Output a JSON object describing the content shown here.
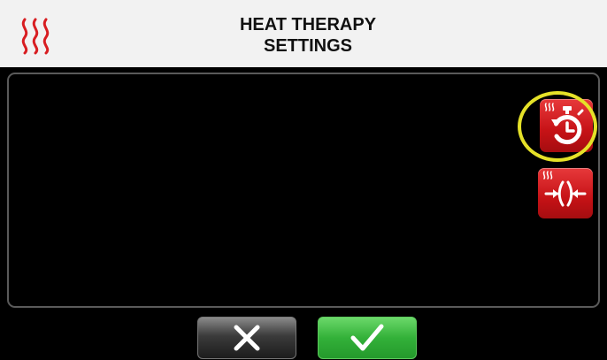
{
  "header": {
    "title_line1": "HEAT THERAPY",
    "title_line2": "SETTINGS",
    "icon": "heat-waves-icon"
  },
  "side_buttons": [
    {
      "icon": "heat-timer-icon",
      "highlighted": true
    },
    {
      "icon": "heat-compress-icon",
      "highlighted": false
    }
  ],
  "actions": {
    "cancel_icon": "close-icon",
    "confirm_icon": "checkmark-icon"
  },
  "colors": {
    "accent_red": "#c61216",
    "confirm_green": "#33b139",
    "highlight_yellow": "#e5e128",
    "header_bg": "#f2f2f2"
  }
}
